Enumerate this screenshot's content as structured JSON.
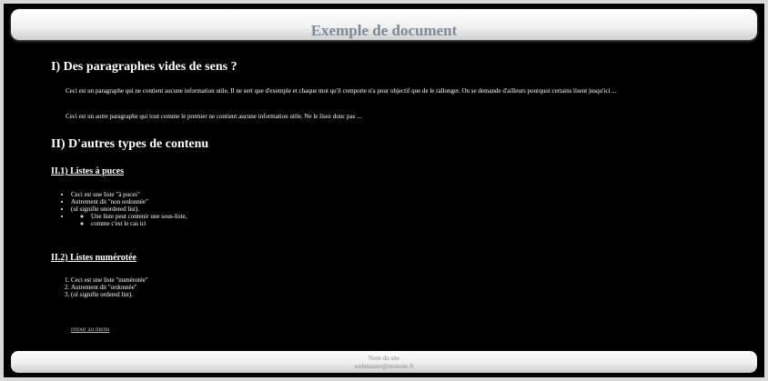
{
  "header": {
    "title": "Exemple de document"
  },
  "section1": {
    "title": "I) Des paragraphes vides de sens ?",
    "paragraphs": [
      "Ceci est un paragraphe qui ne contient aucune information utile. Il ne sert que d'exemple et chaque mot qu'il comporte n'a pour objectif que de le rallonger. On se demande d'ailleurs pourquoi certains lisent jusqu'ici ...",
      "Ceci est un autre paragraphe qui tout comme le premier ne contient aucune information utile. Ne le lisez donc pas ..."
    ]
  },
  "section2": {
    "title": "II) D'autres types de contenu",
    "sub1": {
      "title": "II.1) Listes à puces",
      "items": [
        "Ceci est une liste \"à puces\"",
        "Autrement dit \"non ordonnée\"",
        "(ul signifie unordered list)."
      ],
      "subitems": [
        "Une liste peut contenir une sous-liste,",
        "comme c'est le cas ici"
      ]
    },
    "sub2": {
      "title": "II.2) Listes numérotée",
      "items": [
        "Ceci est une liste \"numérotée\"",
        "Autrement dit \"ordonnée\"",
        "(ol signifie ordered list)."
      ]
    }
  },
  "nav": {
    "back_link": "retour au menu"
  },
  "footer": {
    "site_name": "Nom du site",
    "email": "webmaster@monsite.fr"
  }
}
